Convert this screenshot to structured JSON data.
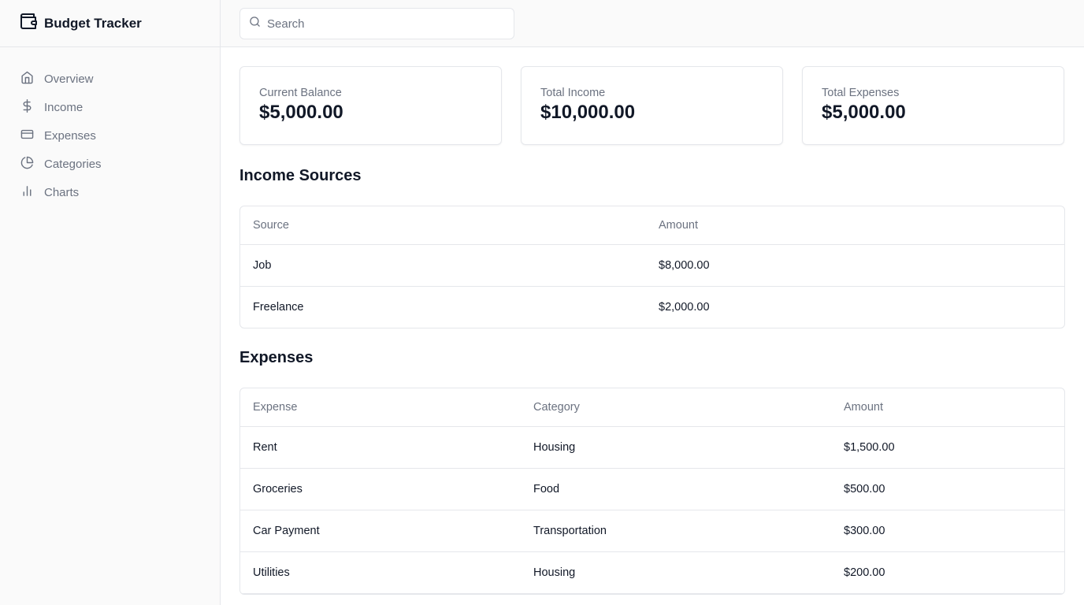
{
  "app": {
    "title": "Budget Tracker",
    "logo_icon": "wallet-icon"
  },
  "sidebar": {
    "items": [
      {
        "label": "Overview",
        "icon": "home-icon"
      },
      {
        "label": "Income",
        "icon": "dollar-icon"
      },
      {
        "label": "Expenses",
        "icon": "credit-card-icon"
      },
      {
        "label": "Categories",
        "icon": "pie-chart-icon"
      },
      {
        "label": "Charts",
        "icon": "bar-chart-icon"
      }
    ]
  },
  "search": {
    "placeholder": "Search",
    "value": ""
  },
  "summary": {
    "balance": {
      "label": "Current Balance",
      "value": "$5,000.00"
    },
    "income": {
      "label": "Total Income",
      "value": "$10,000.00"
    },
    "expenses": {
      "label": "Total Expenses",
      "value": "$5,000.00"
    }
  },
  "income_sources": {
    "title": "Income Sources",
    "columns": [
      "Source",
      "Amount"
    ],
    "rows": [
      [
        "Job",
        "$8,000.00"
      ],
      [
        "Freelance",
        "$2,000.00"
      ]
    ]
  },
  "expenses": {
    "title": "Expenses",
    "columns": [
      "Expense",
      "Category",
      "Amount"
    ],
    "rows": [
      [
        "Rent",
        "Housing",
        "$1,500.00"
      ],
      [
        "Groceries",
        "Food",
        "$500.00"
      ],
      [
        "Car Payment",
        "Transportation",
        "$300.00"
      ],
      [
        "Utilities",
        "Housing",
        "$200.00"
      ]
    ]
  },
  "colors": {
    "muted": "#6b7280",
    "border": "#e5e7eb",
    "sidebar_bg": "#fafafa",
    "text": "#111827"
  }
}
